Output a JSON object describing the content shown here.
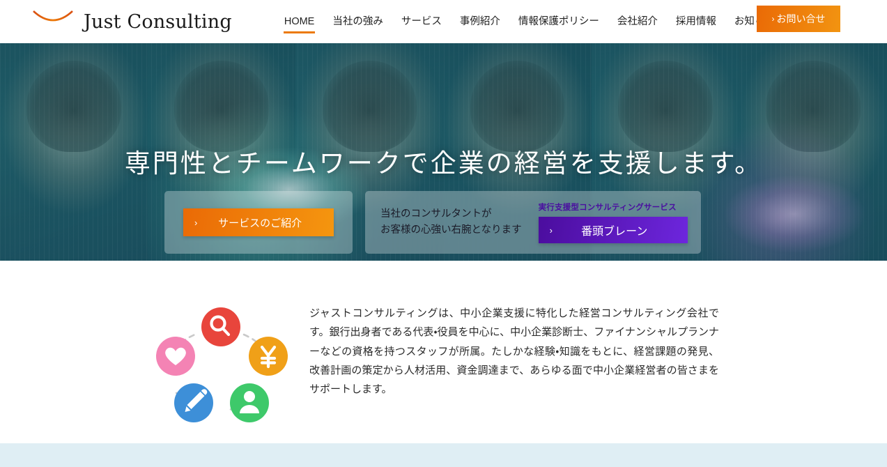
{
  "header": {
    "brand_name": "Just Consulting",
    "logo_icon": "bridge-logo-icon",
    "nav": [
      {
        "label": "HOME",
        "active": true
      },
      {
        "label": "当社の強み",
        "active": false
      },
      {
        "label": "サービス",
        "active": false
      },
      {
        "label": "事例紹介",
        "active": false
      },
      {
        "label": "情報保護ポリシー",
        "active": false
      },
      {
        "label": "会社紹介",
        "active": false
      },
      {
        "label": "採用情報",
        "active": false
      },
      {
        "label": "お知らせ",
        "active": false
      }
    ],
    "cta": {
      "label": "お問い合せ",
      "chevron": "›"
    },
    "accent_color": "#ec7a08"
  },
  "hero": {
    "title": "専門性とチームワークで企業の経営を支援します。",
    "card_a": {
      "button_label": "サービスのご紹介",
      "chevron": "›",
      "button_color": "#ea6a06"
    },
    "card_b": {
      "lede_line1": "当社のコンサルタントが",
      "lede_line2": "お客様の心強い右腕となります",
      "tag": "実行支援型コンサルティングサービス",
      "button_label": "番頭ブレーン",
      "chevron": "›",
      "button_color": "#5416b8",
      "tag_color": "#4a0fa0"
    }
  },
  "about": {
    "paragraph": "ジャストコンサルティングは、中小企業支援に特化した経営コンサルティング会社です。銀行出身者である代表・役員を中心に、中小企業診断士、ファイナンシャルプランナーなどの資格を持つスタッフが所属。たしかな経験・知識をもとに、経営課題の発見、改善計画の策定から人材活用、資金調達まで、あらゆる面で中小企業経営者の皆さまをサポートします。",
    "graphic": {
      "name": "five-circle-diagram",
      "nodes": [
        {
          "icon": "magnifier-icon",
          "color": "#e8453c",
          "position": "top"
        },
        {
          "icon": "yen-icon",
          "color": "#f0a018",
          "position": "right"
        },
        {
          "icon": "person-icon",
          "color": "#3ec96a",
          "position": "bottom-right"
        },
        {
          "icon": "pencil-icon",
          "color": "#3d8fd8",
          "position": "bottom-left"
        },
        {
          "icon": "heart-icon",
          "color": "#f483b4",
          "position": "left"
        }
      ],
      "connector_style": "dashed-arc",
      "connector_color": "#c9c9c9"
    }
  },
  "bottom_band": {
    "color": "#dfeef4"
  }
}
